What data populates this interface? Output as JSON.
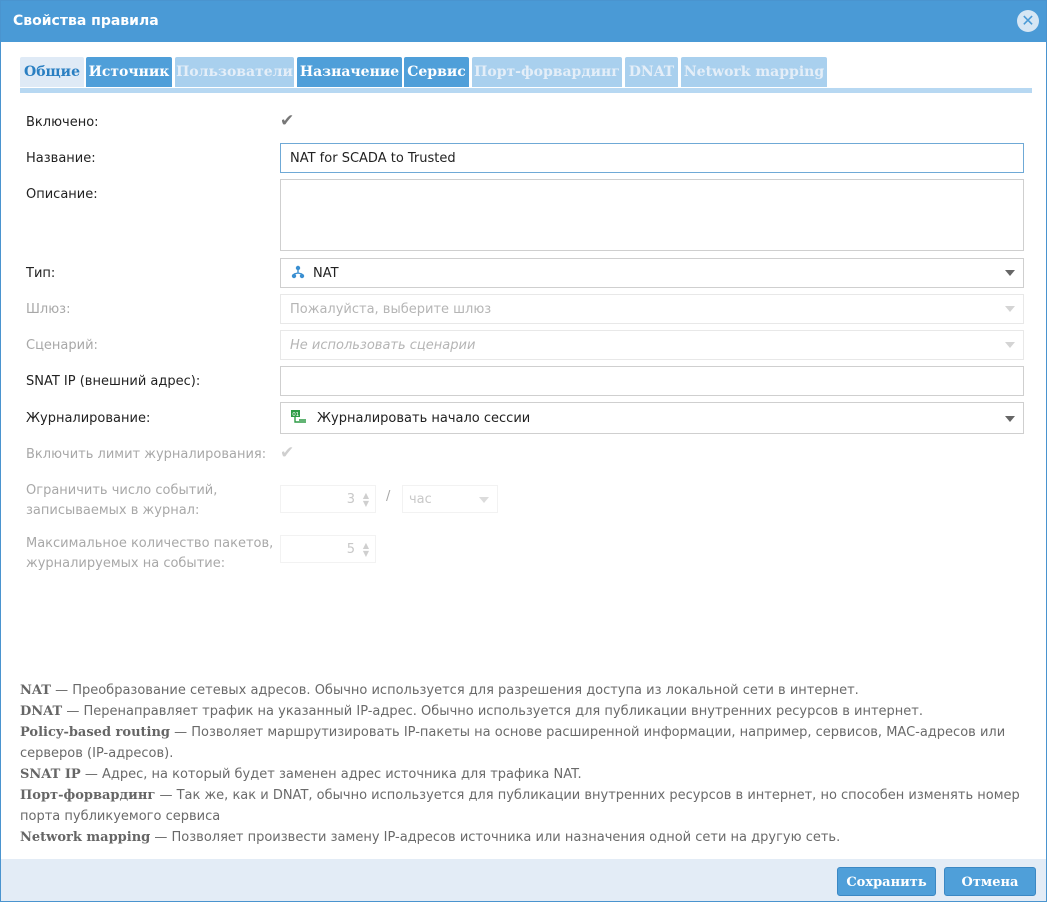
{
  "window": {
    "title": "Свойства правила",
    "close_icon": "close-icon"
  },
  "tabs": [
    {
      "label": "Общие",
      "state": "active"
    },
    {
      "label": "Источник",
      "state": "enabled"
    },
    {
      "label": "Пользователи",
      "state": "disabled"
    },
    {
      "label": "Назначение",
      "state": "enabled"
    },
    {
      "label": "Сервис",
      "state": "enabled"
    },
    {
      "label": "Порт-форвардинг",
      "state": "disabled"
    },
    {
      "label": "DNAT",
      "state": "disabled"
    },
    {
      "label": "Network mapping",
      "state": "disabled"
    }
  ],
  "form": {
    "enabled_label": "Включено:",
    "enabled_checked": true,
    "name_label": "Название:",
    "name_value": "NAT for SCADA to Trusted",
    "description_label": "Описание:",
    "description_value": "",
    "type_label": "Тип:",
    "type_value": "NAT",
    "gateway_label": "Шлюз:",
    "gateway_placeholder": "Пожалуйста, выберите шлюз",
    "scenario_label": "Сценарий:",
    "scenario_placeholder": "Не использовать сценарии",
    "snat_label": "SNAT IP (внешний адрес):",
    "snat_value": "",
    "logging_label": "Журналирование:",
    "logging_value": "Журналировать начало сессии",
    "log_limit_label": "Включить лимит журналирования:",
    "log_limit_checked": true,
    "events_limit_label_1": "Ограничить число событий,",
    "events_limit_label_2": "записываемых в журнал:",
    "events_limit_value": "3",
    "events_limit_sep": "/",
    "events_limit_unit": "час",
    "max_packets_label_1": "Максимальное количество пакетов,",
    "max_packets_label_2": "журналируемых на событие:",
    "max_packets_value": "5"
  },
  "help": {
    "nat_term": "NAT",
    "nat_text": " — Преобразование сетевых адресов. Обычно используется для разрешения доступа из локальной сети в интернет.",
    "dnat_term": "DNAT",
    "dnat_text": " — Перенаправляет трафик на указанный IP-адрес. Обычно используется для публикации внутренних ресурсов в интернет.",
    "pbr_term": "Policy-based routing",
    "pbr_text": " — Позволяет маршрутизировать IP-пакеты на основе расширенной информации, например, сервисов, MAC-адресов или серверов (IP-адресов).",
    "snat_term": "SNAT IP",
    "snat_text": " — Адрес, на который будет заменен адрес источника для трафика NAT.",
    "pf_term": "Порт-форвардинг",
    "pf_text": " — Так же, как и DNAT, обычно используется для публикации внутренних ресурсов в интернет, но способен изменять номер порта публикуемого сервиса",
    "nm_term": "Network mapping",
    "nm_text": " — Позволяет произвести замену IP-адресов источника или назначения одной сети на другую сеть."
  },
  "buttons": {
    "save": "Сохранить",
    "cancel": "Отмена"
  },
  "colors": {
    "accent": "#4a9ad6",
    "tab_disabled": "#a9d0ee",
    "footer": "#e3ecf6"
  }
}
